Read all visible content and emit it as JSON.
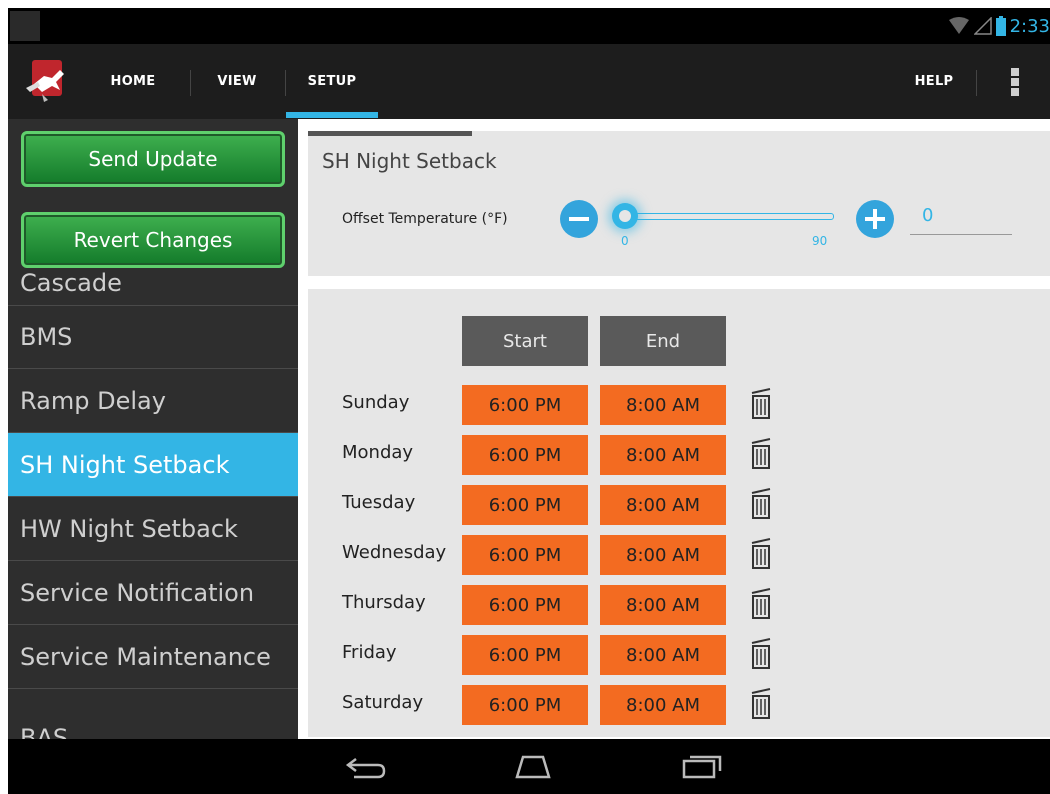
{
  "status_bar": {
    "time": "2:33"
  },
  "action_bar": {
    "tabs": [
      {
        "label": "HOME"
      },
      {
        "label": "VIEW"
      },
      {
        "label": "SETUP"
      }
    ],
    "help_label": "HELP"
  },
  "sidebar": {
    "buttons": {
      "send_update": "Send Update",
      "revert_changes": "Revert Changes"
    },
    "partial_item": "Cascade",
    "items": [
      {
        "label": "BMS"
      },
      {
        "label": "Ramp Delay"
      },
      {
        "label": "SH Night Setback"
      },
      {
        "label": "HW Night Setback"
      },
      {
        "label": "Service Notification"
      },
      {
        "label": "Service Maintenance"
      },
      {
        "label": "BAS"
      }
    ],
    "active_item": "SH Night Setback"
  },
  "setback": {
    "title": "SH Night Setback",
    "offset_label": "Offset Temperature (°F)",
    "slider_min": "0",
    "slider_max": "90",
    "slider_value": 0,
    "value": "0"
  },
  "schedule": {
    "start_header": "Start",
    "end_header": "End",
    "rows": [
      {
        "day": "Sunday",
        "start": "6:00 PM",
        "end": "8:00 AM"
      },
      {
        "day": "Monday",
        "start": "6:00 PM",
        "end": "8:00 AM"
      },
      {
        "day": "Tuesday",
        "start": "6:00 PM",
        "end": "8:00 AM"
      },
      {
        "day": "Wednesday",
        "start": "6:00 PM",
        "end": "8:00 AM"
      },
      {
        "day": "Thursday",
        "start": "6:00 PM",
        "end": "8:00 AM"
      },
      {
        "day": "Friday",
        "start": "6:00 PM",
        "end": "8:00 AM"
      },
      {
        "day": "Saturday",
        "start": "6:00 PM",
        "end": "8:00 AM"
      }
    ]
  },
  "colors": {
    "accent": "#33b5e5",
    "time_cell": "#f36b21",
    "button_green": "#137a2a"
  },
  "icons": [
    "logo-icon",
    "wifi-icon",
    "signal-icon",
    "battery-icon",
    "overflow-menu-icon",
    "minus-icon",
    "plus-icon",
    "trash-icon",
    "back-icon",
    "home-icon",
    "recents-icon"
  ]
}
